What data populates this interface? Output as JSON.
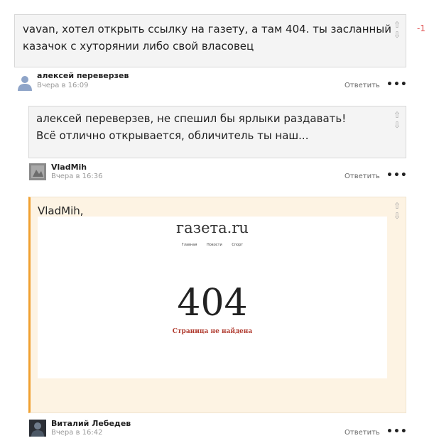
{
  "comments": [
    {
      "text_lines": [
        "vavan, хотел открыть ссылку на газету, а там 404. ты засланный",
        "казачок с хуторянии либо свой власовец"
      ],
      "score": "-1",
      "author": "алексей переверзев",
      "time": "Вчера в 16:09",
      "reply_label": "Ответить"
    },
    {
      "text_lines": [
        "алексей переверзев, не спешил бы ярлыки раздавать!",
        "Всё отлично открывается, обличитель ты наш..."
      ],
      "author": "VladMih",
      "time": "Вчера в 16:36",
      "reply_label": "Ответить"
    },
    {
      "text_lines": [
        "VladMih,"
      ],
      "image": {
        "logo": "газета.ru",
        "nav": [
          "Главная",
          "Новости",
          "Спорт"
        ],
        "code": "404",
        "message": "Страница не найдена"
      },
      "author": "Виталий Лебедев",
      "time": "Вчера в 16:42",
      "reply_label": "Ответить"
    }
  ],
  "icons": {
    "upvote": "⇧",
    "downvote": "⇩",
    "more": "•••"
  },
  "colors": {
    "highlight_bg": "#fdf3e3",
    "highlight_border": "#f0a030",
    "negative_score": "#e05050"
  }
}
